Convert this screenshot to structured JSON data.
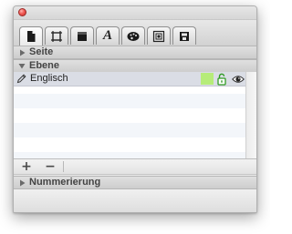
{
  "sections": {
    "page": {
      "title": "Seite",
      "expanded": false
    },
    "layer": {
      "title": "Ebene",
      "expanded": true
    },
    "numbering": {
      "title": "Nummerierung",
      "expanded": false
    }
  },
  "tabs": [
    {
      "icon": "document-icon",
      "active": true
    },
    {
      "icon": "frame-icon",
      "active": false
    },
    {
      "icon": "fill-icon",
      "active": false
    },
    {
      "icon": "text-icon",
      "active": false,
      "glyph": "A"
    },
    {
      "icon": "palette-icon",
      "active": false
    },
    {
      "icon": "image-icon",
      "active": false
    },
    {
      "icon": "export-icon",
      "active": false
    }
  ],
  "layers": [
    {
      "name": "Englisch",
      "color": "#b6ec79",
      "locked": false,
      "visible": true
    }
  ],
  "toolbar": {
    "add_label": "+",
    "remove_label": "−"
  },
  "colors": {
    "selection_row": "#dadde5",
    "close_button": "#f15b55",
    "layer_color": "#b6ec79"
  }
}
